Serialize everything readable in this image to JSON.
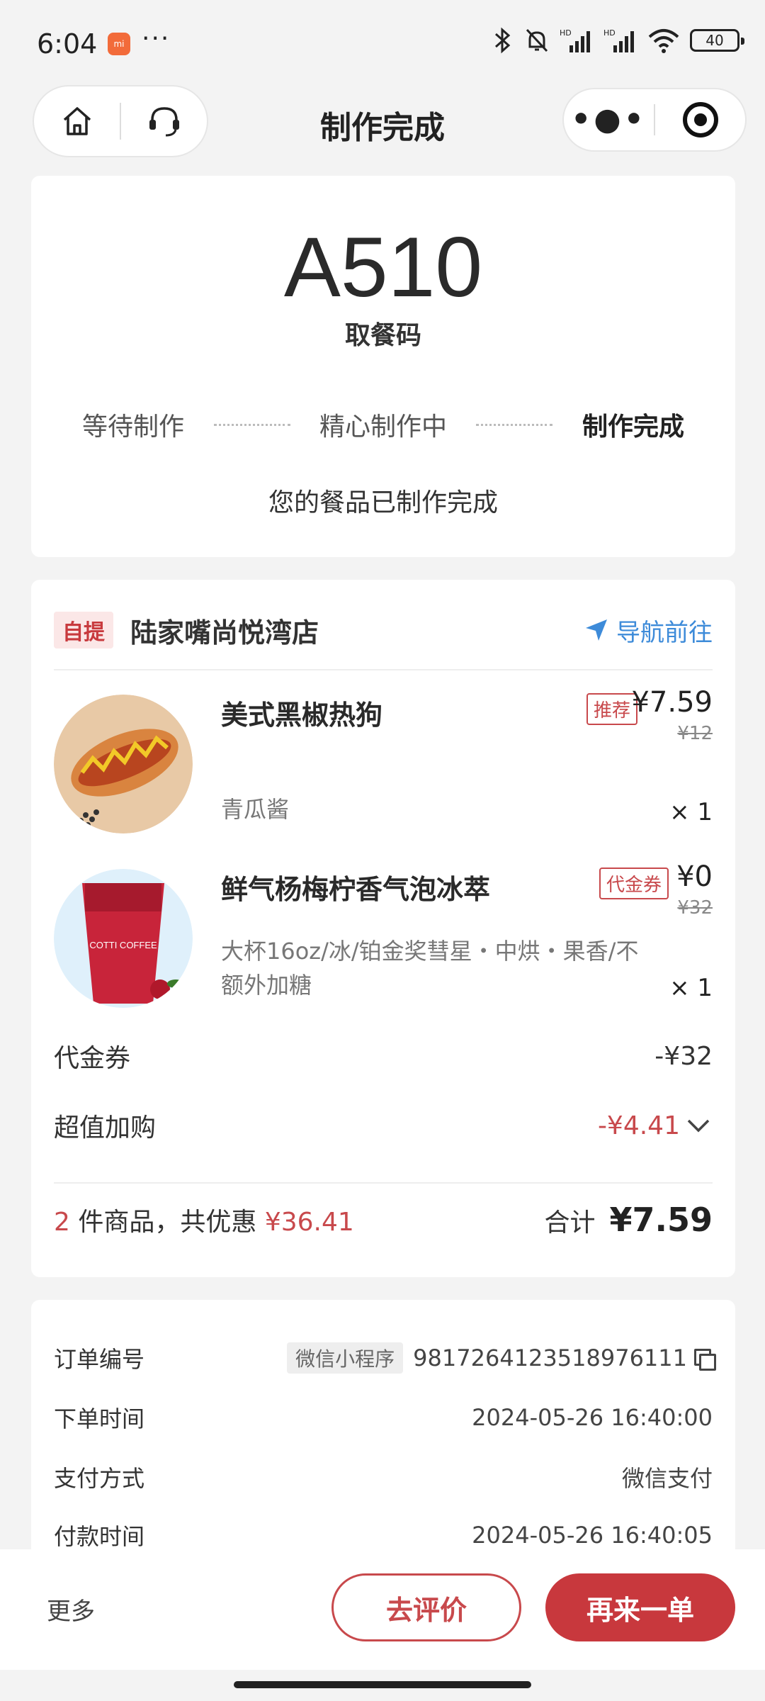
{
  "status_bar": {
    "time": "6:04",
    "more": "···",
    "battery": "40",
    "icons": [
      "bluetooth-icon",
      "mute-icon",
      "hd-signal-icon",
      "hd-signal-icon",
      "wifi-icon",
      "battery-icon"
    ]
  },
  "nav": {
    "title": "制作完成",
    "left_icons": [
      "home-icon",
      "headset-icon"
    ],
    "right_icons": [
      "more-dots-icon",
      "close-target-icon"
    ]
  },
  "pickup": {
    "code": "A510",
    "code_label": "取餐码",
    "steps": [
      "等待制作",
      "精心制作中",
      "制作完成"
    ],
    "active_step": 2,
    "message": "您的餐品已制作完成"
  },
  "order": {
    "pickup_tag": "自提",
    "store_name": "陆家嘴尚悦湾店",
    "navigate_label": "导航前往",
    "items": [
      {
        "name": "美式黑椒热狗",
        "spec": "青瓜酱",
        "tag": "推荐",
        "price": "¥7.59",
        "original_price": "¥12",
        "qty": "× 1"
      },
      {
        "name": "鲜气杨梅柠香气泡冰萃",
        "spec": "大杯16oz/冰/铂金奖彗星・中烘・果香/不额外加糖",
        "tag": "代金券",
        "price": "¥0",
        "original_price": "¥32",
        "qty": "× 1",
        "cup_text": "COTTI COFFEE"
      }
    ],
    "voucher_label": "代金券",
    "voucher_value": "-¥32",
    "addon_label": "超值加购",
    "addon_value": "-¥4.41",
    "summary_count": "2",
    "summary_text": "件商品，共优惠",
    "summary_discount": "¥36.41",
    "total_label": "合计",
    "total_value": "¥7.59"
  },
  "info": {
    "order_no_label": "订单编号",
    "order_channel": "微信小程序",
    "order_no": "9817264123518976111",
    "order_time_label": "下单时间",
    "order_time": "2024-05-26 16:40:00",
    "pay_method_label": "支付方式",
    "pay_method": "微信支付",
    "pay_time_label": "付款时间",
    "pay_time": "2024-05-26 16:40:05"
  },
  "bottom": {
    "more": "更多",
    "review": "去评价",
    "reorder": "再来一单"
  },
  "colors": {
    "accent_red": "#c8383d",
    "link_blue": "#3d8bd9",
    "background": "#f3f3f3"
  }
}
